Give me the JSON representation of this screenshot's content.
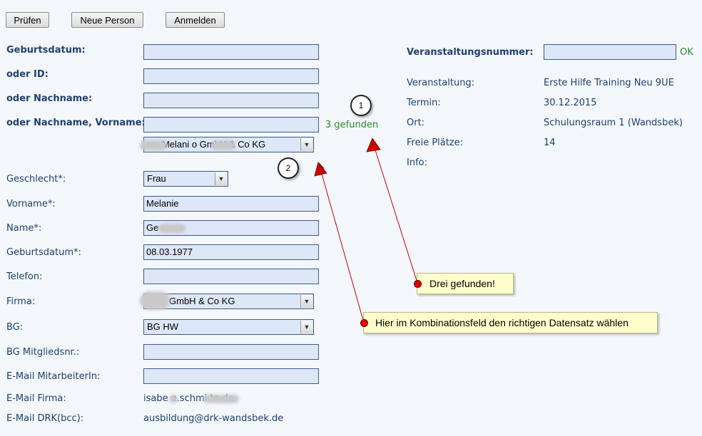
{
  "toolbar": {
    "check_label": "Prüfen",
    "new_person_label": "Neue Person",
    "register_label": "Anmelden"
  },
  "search": {
    "birthdate_label": "Geburtsdatum:",
    "id_label": "oder ID:",
    "lastname_label": "oder Nachname:",
    "lastname_firstname_label": "oder Nachname, Vorname:",
    "birthdate_value": "",
    "id_value": "",
    "lastname_value": "",
    "lastname_firstname_value": "",
    "found_text": "3 gefunden",
    "result_select_value": "se, Melani          o GmbH & Co KG"
  },
  "person": {
    "gender_label": "Geschlecht*:",
    "gender_value": "Frau",
    "firstname_label": "Vorname*:",
    "firstname_value": "Melanie",
    "name_label": "Name*:",
    "name_value": "Ge",
    "birthdate_label": "Geburtsdatum*:",
    "birthdate_value": "08.03.1977",
    "phone_label": "Telefon:",
    "phone_value": "",
    "company_label": "Firma:",
    "company_value": "GmbH & Co KG",
    "bg_label": "BG:",
    "bg_value": "BG HW",
    "bg_member_label": "BG Mitgliedsnr.:",
    "bg_member_value": "",
    "email_employee_label": "E-Mail MitarbeiterIn:",
    "email_employee_value": "",
    "email_company_label": "E-Mail Firma:",
    "email_company_value": "isabe  e.schmi          to.de",
    "email_drk_label": "E-Mail DRK(bcc):",
    "email_drk_value": "ausbildung@drk-wandsbek.de"
  },
  "event": {
    "number_label": "Veranstaltungsnummer:",
    "number_value": "",
    "status": "OK",
    "event_label": "Veranstaltung:",
    "event_value": "Erste Hilfe Training Neu 9UE",
    "date_label": "Termin:",
    "date_value": "30.12.2015",
    "place_label": "Ort:",
    "place_value": "Schulungsraum 1 (Wandsbek)",
    "seats_label": "Freie Plätze:",
    "seats_value": "14",
    "info_label": "Info:"
  },
  "annotations": {
    "marker_1": "1",
    "marker_2": "2",
    "note_1": "Drei gefunden!",
    "note_2": "Hier im Kombinationsfeld den richtigen Datensatz wählen",
    "arrow_color": "#cc0000"
  },
  "icons": {
    "select_arrow": "chevron-down-icon"
  }
}
